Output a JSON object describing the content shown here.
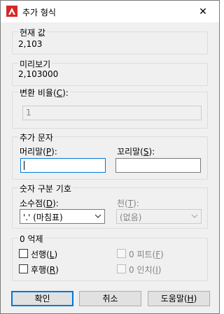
{
  "window": {
    "title": "추가 형식",
    "close_glyph": "✕"
  },
  "current_value": {
    "label": "현재 값",
    "value": "2,103"
  },
  "preview": {
    "label": "미리보기",
    "value": "2,103000"
  },
  "conversion_factor": {
    "label": "변환 비율(",
    "mnemonic": "C",
    "suffix": "):",
    "value": "1"
  },
  "additional_text": {
    "label": "추가 문자",
    "prefix_label": "머리말(",
    "prefix_mnemonic": "P",
    "prefix_suffix": "):",
    "prefix_value": "",
    "suffix_label": "꼬리말(",
    "suffix_mnemonic": "S",
    "suffix_suffix": "):",
    "suffix_value": ""
  },
  "digit_grouping": {
    "label": "숫자 구분 기호",
    "decimal_label": "소수점(",
    "decimal_mnemonic": "D",
    "decimal_suffix": "):",
    "decimal_value": "'.' (마침표)",
    "thousands_label": "천(",
    "thousands_mnemonic": "T",
    "thousands_suffix": "):",
    "thousands_value": "(없음)"
  },
  "zero_suppression": {
    "label": "0 억제",
    "leading_label": "선행(",
    "leading_mnemonic": "L",
    "leading_suffix": ")",
    "trailing_label": "후행(",
    "trailing_mnemonic": "R",
    "trailing_suffix": ")",
    "feet_label": "0 피트(",
    "feet_mnemonic": "F",
    "feet_suffix": ")",
    "inches_label": "0 인치(",
    "inches_mnemonic": "I",
    "inches_suffix": ")"
  },
  "buttons": {
    "ok": "확인",
    "cancel": "취소",
    "help_label": "도움말(",
    "help_mnemonic": "H",
    "help_suffix": ")"
  },
  "colors": {
    "accent": "#0078d7",
    "app_icon": "#d62828"
  }
}
